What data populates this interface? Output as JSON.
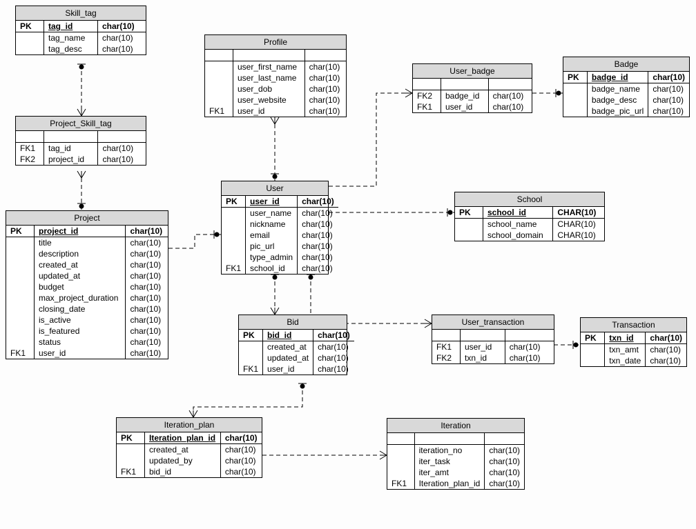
{
  "pk": "PK",
  "default_type": "char(10)",
  "skill_tag": {
    "title": "Skill_tag",
    "pk_field": "tag_id",
    "rows": [
      {
        "k": "",
        "n": "tag_name",
        "t": "char(10)"
      },
      {
        "k": "",
        "n": "tag_desc",
        "t": "char(10)"
      }
    ]
  },
  "project_skill_tag": {
    "title": "Project_Skill_tag",
    "rows": [
      {
        "k": "FK1",
        "n": "tag_id",
        "t": "char(10)"
      },
      {
        "k": "FK2",
        "n": "project_id",
        "t": "char(10)"
      }
    ]
  },
  "project": {
    "title": "Project",
    "pk_field": "project_id",
    "rows": [
      {
        "k": "",
        "n": "title",
        "t": "char(10)"
      },
      {
        "k": "",
        "n": "description",
        "t": "char(10)"
      },
      {
        "k": "",
        "n": "created_at",
        "t": "char(10)"
      },
      {
        "k": "",
        "n": "updated_at",
        "t": "char(10)"
      },
      {
        "k": "",
        "n": "budget",
        "t": "char(10)"
      },
      {
        "k": "",
        "n": "max_project_duration",
        "t": "char(10)"
      },
      {
        "k": "",
        "n": "closing_date",
        "t": "char(10)"
      },
      {
        "k": "",
        "n": "is_active",
        "t": "char(10)"
      },
      {
        "k": "",
        "n": "is_featured",
        "t": "char(10)"
      },
      {
        "k": "",
        "n": "status",
        "t": "char(10)"
      },
      {
        "k": "FK1",
        "n": "user_id",
        "t": "char(10)"
      }
    ]
  },
  "profile": {
    "title": "Profile",
    "rows": [
      {
        "k": "",
        "n": "user_first_name",
        "t": "char(10)"
      },
      {
        "k": "",
        "n": "user_last_name",
        "t": "char(10)"
      },
      {
        "k": "",
        "n": "user_dob",
        "t": "char(10)"
      },
      {
        "k": "",
        "n": "user_website",
        "t": "char(10)"
      },
      {
        "k": "FK1",
        "n": "user_id",
        "t": "char(10)"
      }
    ]
  },
  "user": {
    "title": "User",
    "pk_field": "user_id",
    "rows": [
      {
        "k": "",
        "n": "user_name",
        "t": "char(10)"
      },
      {
        "k": "",
        "n": "nickname",
        "t": "char(10)"
      },
      {
        "k": "",
        "n": "email",
        "t": "char(10)"
      },
      {
        "k": "",
        "n": "pic_url",
        "t": "char(10)"
      },
      {
        "k": "",
        "n": "type_admin",
        "t": "char(10)"
      },
      {
        "k": "FK1",
        "n": "school_id",
        "t": "char(10)"
      }
    ]
  },
  "user_badge": {
    "title": "User_badge",
    "rows": [
      {
        "k": "FK2",
        "n": "badge_id",
        "t": "char(10)"
      },
      {
        "k": "FK1",
        "n": "user_id",
        "t": "char(10)"
      }
    ]
  },
  "badge": {
    "title": "Badge",
    "pk_field": "badge_id",
    "rows": [
      {
        "k": "",
        "n": "badge_name",
        "t": "char(10)"
      },
      {
        "k": "",
        "n": "badge_desc",
        "t": "char(10)"
      },
      {
        "k": "",
        "n": "badge_pic_url",
        "t": "char(10)"
      }
    ]
  },
  "school": {
    "title": "School",
    "pk_field": "school_id",
    "pk_type": "CHAR(10)",
    "rows": [
      {
        "k": "",
        "n": "school_name",
        "t": "CHAR(10)"
      },
      {
        "k": "",
        "n": "school_domain",
        "t": "CHAR(10)"
      }
    ]
  },
  "bid": {
    "title": "Bid",
    "pk_field": "bid_id",
    "rows": [
      {
        "k": "",
        "n": "created_at",
        "t": "char(10)"
      },
      {
        "k": "",
        "n": "updated_at",
        "t": "char(10)"
      },
      {
        "k": "FK1",
        "n": "user_id",
        "t": "char(10)"
      }
    ]
  },
  "user_transaction": {
    "title": "User_transaction",
    "rows": [
      {
        "k": "FK1",
        "n": "user_id",
        "t": "char(10)"
      },
      {
        "k": "FK2",
        "n": "txn_id",
        "t": "char(10)"
      }
    ]
  },
  "transaction": {
    "title": "Transaction",
    "pk_field": "txn_id",
    "rows": [
      {
        "k": "",
        "n": "txn_amt",
        "t": "char(10)"
      },
      {
        "k": "",
        "n": "txn_date",
        "t": "char(10)"
      }
    ]
  },
  "iteration_plan": {
    "title": "Iteration_plan",
    "pk_field": "Iteration_plan_id",
    "rows": [
      {
        "k": "",
        "n": "created_at",
        "t": "char(10)"
      },
      {
        "k": "",
        "n": "updated_by",
        "t": "char(10)"
      },
      {
        "k": "FK1",
        "n": "bid_id",
        "t": "char(10)"
      }
    ]
  },
  "iteration": {
    "title": "Iteration",
    "rows": [
      {
        "k": "",
        "n": "iteration_no",
        "t": "char(10)"
      },
      {
        "k": "",
        "n": "iter_task",
        "t": "char(10)"
      },
      {
        "k": "",
        "n": "iter_amt",
        "t": "char(10)"
      },
      {
        "k": "FK1",
        "n": "Iteration_plan_id",
        "t": "char(10)"
      }
    ]
  }
}
